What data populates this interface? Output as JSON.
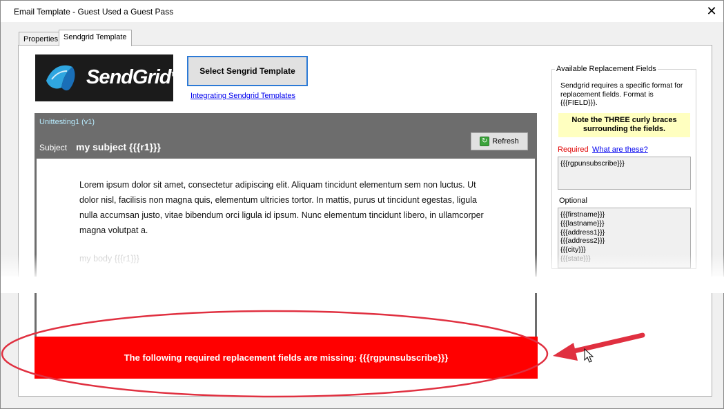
{
  "window": {
    "title": "Email Template - Guest Used a Guest Pass",
    "close_glyph": "✕"
  },
  "tabs": [
    {
      "label": "Properties",
      "active": false
    },
    {
      "label": "Sendgrid Template",
      "active": true
    }
  ],
  "logo": {
    "text": "SendGrid",
    "tm": "TM"
  },
  "toolbar": {
    "select_template_label": "Select Sengrid Template",
    "integrating_link": "Integrating Sendgrid Templates"
  },
  "preview": {
    "template_name": "Unittesting1 (v1)",
    "subject_label": "Subject",
    "subject_value": "my subject {{{r1}}}",
    "refresh_label": "Refresh",
    "body_text": "Lorem ipsum dolor sit amet, consectetur adipiscing elit. Aliquam tincidunt elementum sem non luctus. Ut dolor nisl, facilisis non magna quis, elementum ultricies tortor. In mattis, purus ut tincidunt egestas, ligula nulla accumsan justo, vitae bibendum orci ligula id ipsum. Nunc elementum tincidunt libero, in ullamcorper magna volutpat a.",
    "body_placeholder": "my body {{{r1}}}"
  },
  "error": {
    "message": "The following required replacement fields are missing: {{{rgpunsubscribe}}}",
    "color": "#ff0000"
  },
  "replacement_fields": {
    "legend": "Available Replacement Fields",
    "description": "Sendgrid requires a specific format for replacement fields.  Format is {{{FIELD}}}.",
    "note": "Note the THREE curly braces surrounding the fields.",
    "required_label": "Required",
    "what_link": "What are these?",
    "required": [
      "{{{rgpunsubscribe}}}"
    ],
    "optional_label": "Optional",
    "optional": [
      "{{{firstname}}}",
      "{{{lastname}}}",
      "{{{address1}}}",
      "{{{address2}}}",
      "{{{city}}}",
      "{{{state}}}"
    ]
  },
  "colors": {
    "accent_border": "#2c7ad6",
    "annotation": "#e03040"
  }
}
